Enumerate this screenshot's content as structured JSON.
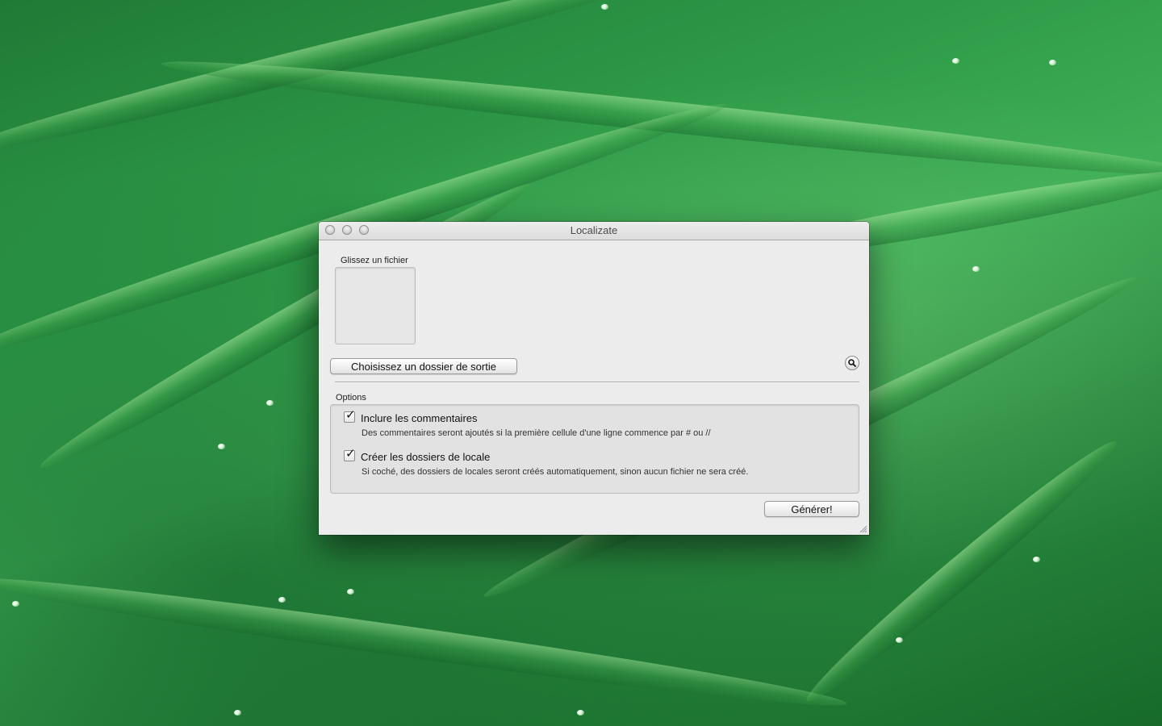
{
  "window": {
    "title": "Localizate"
  },
  "drop_area": {
    "label": "Glissez un fichier"
  },
  "output": {
    "choose_button_label": "Choisissez un dossier de sortie"
  },
  "options": {
    "section_label": "Options",
    "items": [
      {
        "label": "Inclure les commentaires",
        "checked": true,
        "description": "Des commentaires seront ajoutés si la première cellule d'une ligne commence par # ou //"
      },
      {
        "label": "Créer les dossiers de locale",
        "checked": true,
        "description": "Si coché, des dossiers de locales seront créés automatiquement, sinon aucun fichier ne sera créé."
      }
    ]
  },
  "actions": {
    "generate_label": "Générer!"
  },
  "icons": {
    "window_close": "close-icon",
    "window_minimize": "minimize-icon",
    "window_zoom": "zoom-icon",
    "reveal": "magnifier-icon",
    "checkmark": "checkmark-icon",
    "resize": "resize-grip-icon"
  },
  "colors": {
    "window_bg": "#ececec",
    "options_bg": "#e2e2e2",
    "desktop_green": "#2e9a48"
  }
}
